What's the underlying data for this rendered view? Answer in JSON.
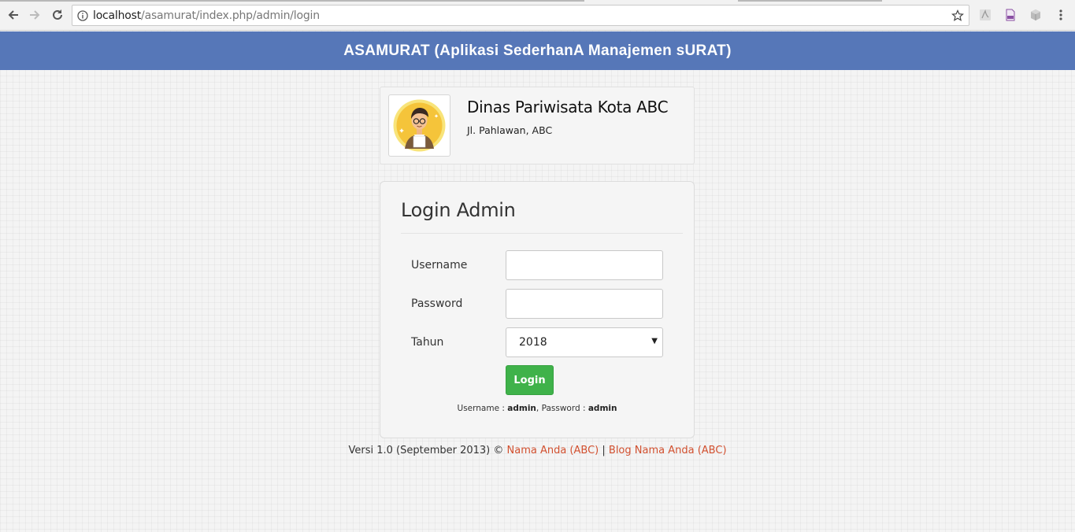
{
  "browser": {
    "url_host": "localhost",
    "url_path": "/asamurat/index.php/admin/login"
  },
  "header": {
    "title": "ASAMURAT (Aplikasi SederhanA Manajemen sURAT)"
  },
  "org": {
    "name": "Dinas Pariwisata Kota ABC",
    "address": "Jl. Pahlawan, ABC"
  },
  "login": {
    "title": "Login Admin",
    "username_label": "Username",
    "username_value": "",
    "password_label": "Password",
    "password_value": "",
    "year_label": "Tahun",
    "year_value": "2018",
    "button_label": "Login",
    "hint_prefix_user": "Username : ",
    "hint_user": "admin",
    "hint_prefix_pass": ", Password : ",
    "hint_pass": "admin"
  },
  "footer": {
    "version_text": "Versi 1.0 (September 2013) © ",
    "author_link": "Nama Anda (ABC)",
    "separator": " | ",
    "blog_link": "Blog Nama Anda (ABC)"
  },
  "colors": {
    "header_bg": "#5677b8",
    "button_green": "#3fb24a",
    "link_red": "#d2502f"
  }
}
